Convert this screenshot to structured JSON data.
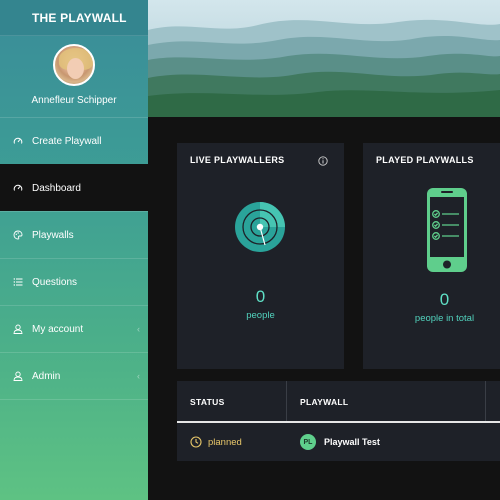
{
  "sidebar": {
    "brand": "THE PLAYWALL",
    "user_name": "Annefleur Schipper",
    "items": [
      {
        "label": "Create Playwall",
        "icon": "gauge-icon"
      },
      {
        "label": "Dashboard",
        "icon": "gauge-icon",
        "active": true
      },
      {
        "label": "Playwalls",
        "icon": "palette-icon"
      },
      {
        "label": "Questions",
        "icon": "list-icon"
      },
      {
        "label": "My account",
        "icon": "user-icon",
        "has_chevron": true
      },
      {
        "label": "Admin",
        "icon": "user-icon",
        "has_chevron": true
      }
    ]
  },
  "cards": {
    "live": {
      "title": "LIVE PLAYWALLERS",
      "value": "0",
      "unit": "people",
      "icon": "radar-icon"
    },
    "played": {
      "title": "PLAYED PLAYWALLS",
      "value": "0",
      "unit": "people in total",
      "icon": "phone-checklist-icon"
    }
  },
  "table": {
    "headers": [
      "STATUS",
      "PLAYWALL"
    ],
    "rows": [
      {
        "status": "planned",
        "badge": "PL",
        "playwall": "Playwall Test"
      }
    ]
  },
  "colors": {
    "accent_teal": "#5fe0c6",
    "status_planned": "#e8c76a",
    "card_bg": "#1e2128",
    "page_bg": "#121212"
  }
}
